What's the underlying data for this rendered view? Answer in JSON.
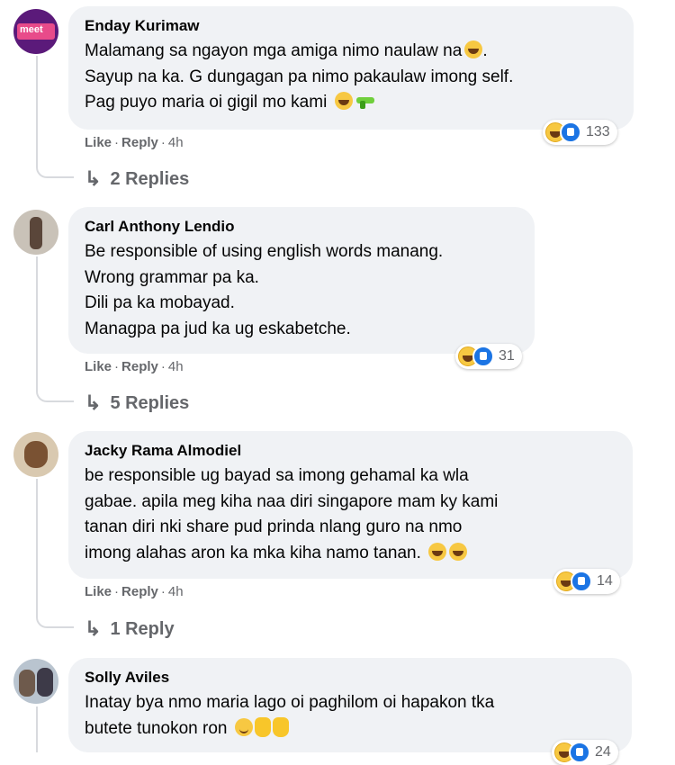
{
  "comments": [
    {
      "author": "Enday Kurimaw",
      "avatar_text": "meet",
      "lines": [
        "Malamang sa ngayon mga amiga nimo naulaw na",
        "Sayup na ka. G dungagan pa nimo pakaulaw imong self.",
        "Pag puyo maria oi gigil mo kami"
      ],
      "like": "Like",
      "reply": "Reply",
      "time": "4h",
      "reaction_count": "133",
      "replies_label": "2 Replies"
    },
    {
      "author": "Carl Anthony Lendio",
      "lines": [
        "Be responsible of using english words manang.",
        "Wrong grammar pa ka.",
        "Dili pa ka mobayad.",
        "Managpa pa jud ka ug eskabetche."
      ],
      "like": "Like",
      "reply": "Reply",
      "time": "4h",
      "reaction_count": "31",
      "replies_label": "5 Replies"
    },
    {
      "author": "Jacky Rama Almodiel",
      "lines": [
        "be responsible ug bayad sa imong gehamal ka wla",
        "gabae. apila meg kiha naa diri singapore mam ky kami",
        "tanan diri nki share pud prinda nlang guro na nmo",
        "imong alahas aron ka mka kiha namo tanan."
      ],
      "like": "Like",
      "reply": "Reply",
      "time": "4h",
      "reaction_count": "14",
      "replies_label": "1 Reply"
    },
    {
      "author": "Solly Aviles",
      "lines": [
        "Inatay bya nmo maria lago oi paghilom oi hapakon tka",
        "butete tunokon ron"
      ],
      "reaction_count": "24"
    }
  ],
  "separator": "·",
  "reply_arrow": "↳",
  "colors": {
    "bubble": "#f0f2f5",
    "meta": "#65676b",
    "like_blue": "#1b74e4",
    "haha_yellow": "#f7c842"
  }
}
